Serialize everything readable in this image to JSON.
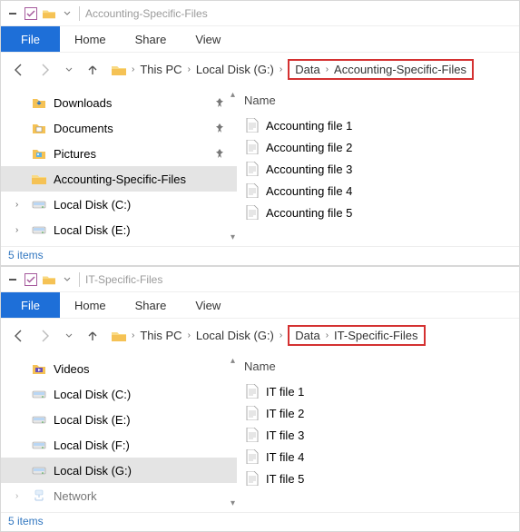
{
  "windows": [
    {
      "title": "Accounting-Specific-Files",
      "ribbon_file": "File",
      "ribbon_tabs": [
        "Home",
        "Share",
        "View"
      ],
      "breadcrumb": [
        "This PC",
        "Local Disk (G:)",
        "Data",
        "Accounting-Specific-Files"
      ],
      "highlight_from_index": 2,
      "tree": [
        {
          "label": "Downloads",
          "icon": "downloads",
          "pinned": true
        },
        {
          "label": "Documents",
          "icon": "documents",
          "pinned": true
        },
        {
          "label": "Pictures",
          "icon": "pictures",
          "pinned": true
        },
        {
          "label": "Accounting-Specific-Files",
          "icon": "folder",
          "selected": true
        },
        {
          "label": "Local Disk (C:)",
          "icon": "disk",
          "expandable": true
        },
        {
          "label": "Local Disk (E:)",
          "icon": "disk",
          "expandable": true
        }
      ],
      "list_header": "Name",
      "files": [
        "Accounting file 1",
        "Accounting file 2",
        "Accounting file 3",
        "Accounting file 4",
        "Accounting file 5"
      ],
      "status": "5 items"
    },
    {
      "title": "IT-Specific-Files",
      "ribbon_file": "File",
      "ribbon_tabs": [
        "Home",
        "Share",
        "View"
      ],
      "breadcrumb": [
        "This PC",
        "Local Disk (G:)",
        "Data",
        "IT-Specific-Files"
      ],
      "highlight_from_index": 2,
      "tree": [
        {
          "label": "Videos",
          "icon": "videos"
        },
        {
          "label": "Local Disk (C:)",
          "icon": "disk"
        },
        {
          "label": "Local Disk (E:)",
          "icon": "disk"
        },
        {
          "label": "Local Disk (F:)",
          "icon": "disk"
        },
        {
          "label": "Local Disk (G:)",
          "icon": "disk",
          "selected": true
        },
        {
          "label": "Network",
          "icon": "network",
          "expandable": true,
          "dim": true
        }
      ],
      "list_header": "Name",
      "files": [
        "IT file 1",
        "IT file 2",
        "IT file 3",
        "IT file 4",
        "IT file 5"
      ],
      "status": "5 items"
    }
  ]
}
